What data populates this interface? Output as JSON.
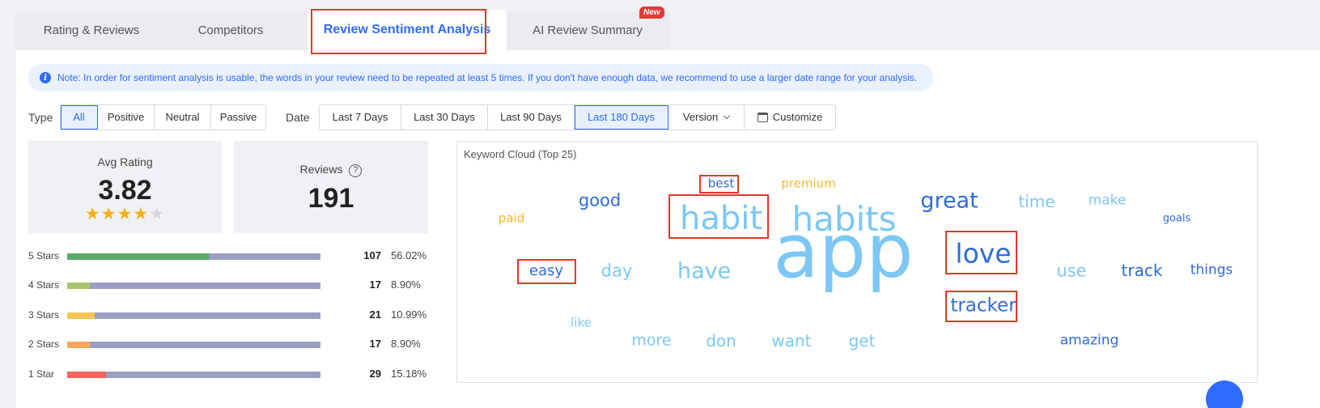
{
  "tabs": [
    {
      "label": "Rating & Reviews",
      "active": false
    },
    {
      "label": "Competitors",
      "active": false
    },
    {
      "label": "Review Sentiment Analysis",
      "active": true
    },
    {
      "label": "AI Review Summary",
      "active": false,
      "badge": "New"
    }
  ],
  "note": {
    "icon": "info-icon",
    "text": "Note: In order for sentiment analysis is usable, the words in your review need to be repeated at least 5 times. If you don't have enough data, we recommend to use a larger date range for your analysis."
  },
  "filters": {
    "type_label": "Type",
    "type_options": [
      "All",
      "Positive",
      "Neutral",
      "Passive"
    ],
    "type_selected": "All",
    "date_label": "Date",
    "date_options": [
      "Last 7 Days",
      "Last 30 Days",
      "Last 90 Days",
      "Last 180 Days"
    ],
    "date_selected": "Last 180 Days",
    "version_label": "Version",
    "customize_label": "Customize"
  },
  "stats": {
    "avg_rating_label": "Avg Rating",
    "avg_rating": "3.82",
    "stars_filled": 4,
    "stars_total": 5,
    "reviews_label": "Reviews",
    "reviews": "191"
  },
  "rating_breakdown": [
    {
      "label": "5 Stars",
      "count": "107",
      "percent": "56.02%",
      "fraction": 0.5602,
      "color": "#5bab6a"
    },
    {
      "label": "4 Stars",
      "count": "17",
      "percent": "8.90%",
      "fraction": 0.089,
      "color": "#aac56d"
    },
    {
      "label": "3 Stars",
      "count": "21",
      "percent": "10.99%",
      "fraction": 0.1099,
      "color": "#f7c557"
    },
    {
      "label": "2 Stars",
      "count": "17",
      "percent": "8.90%",
      "fraction": 0.089,
      "color": "#f9a85b"
    },
    {
      "label": "1 Star",
      "count": "29",
      "percent": "15.18%",
      "fraction": 0.1518,
      "color": "#f2665f"
    }
  ],
  "keyword_cloud": {
    "title": "Keyword Cloud (Top 25)",
    "words": [
      "best",
      "premium",
      "good",
      "habit",
      "habits",
      "great",
      "time",
      "make",
      "paid",
      "goals",
      "app",
      "love",
      "easy",
      "day",
      "have",
      "use",
      "track",
      "things",
      "tracker",
      "like",
      "more",
      "don",
      "want",
      "get",
      "amazing"
    ]
  },
  "colors": {
    "accent": "#2f6bff",
    "word_light_blue": "#7cc7f5",
    "word_blue": "#2f6bd8",
    "word_yellow": "#f4b92f",
    "highlight": "#e2372b"
  }
}
